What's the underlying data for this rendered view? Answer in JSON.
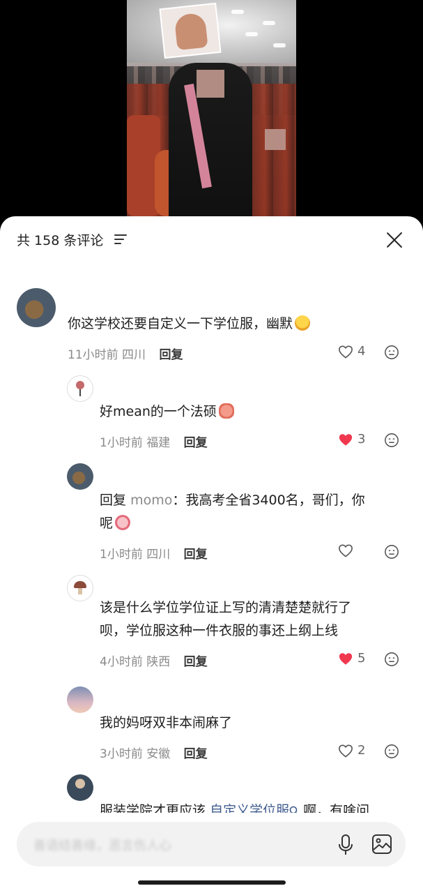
{
  "header": {
    "comment_count": "共 158 条评论"
  },
  "comments": [
    {
      "text": "你这学校还要自定义一下学位服，幽默",
      "time": "11小时前",
      "location": "四川",
      "reply_label": "回复",
      "likes": "4",
      "liked": false
    },
    {
      "text": "好mean的一个法硕",
      "time": "1小时前",
      "location": "福建",
      "reply_label": "回复",
      "likes": "3",
      "liked": true
    },
    {
      "reply_prefix": "回复",
      "mention": "momo",
      "text": "：我高考全省3400名，哥们，你",
      "text_line2": "呢",
      "time": "1小时前",
      "location": "四川",
      "reply_label": "回复",
      "likes": "",
      "liked": false
    },
    {
      "text": "该是什么学位学位证上写的清清楚楚就行了",
      "text_line2": "呗，学位服这种一件衣服的事还上纲上线",
      "time": "4小时前",
      "location": "陕西",
      "reply_label": "回复",
      "likes": "5",
      "liked": true
    },
    {
      "text": "我的妈呀双非本闹麻了",
      "time": "3小时前",
      "location": "安徽",
      "reply_label": "回复",
      "likes": "2",
      "liked": false
    },
    {
      "text": "服装学院才更应该",
      "link": "自定义学位服",
      "text_after": "啊，有啥问"
    }
  ],
  "input": {
    "placeholder": "善语结善缘，恶言伤人心"
  },
  "colors": {
    "liked_heart": "#f0384f",
    "link": "#3f5c8f",
    "text_muted": "#8a8a8a"
  }
}
